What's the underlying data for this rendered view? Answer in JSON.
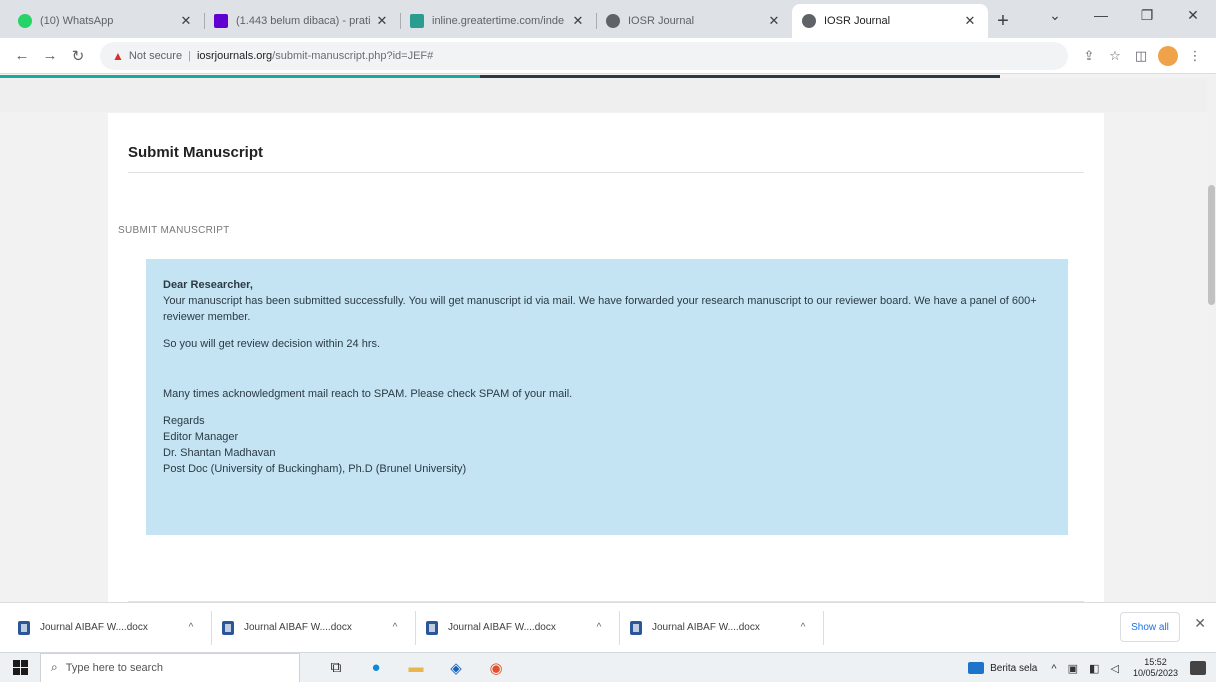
{
  "browser": {
    "tabs": [
      {
        "title": "(10) WhatsApp",
        "favicon_color": "#25d366",
        "active": false
      },
      {
        "title": "(1.443 belum dibaca) - prati",
        "favicon_color": "#6001d2",
        "active": false
      },
      {
        "title": "inline.greatertime.com/inde",
        "favicon_color": "#2a9d8f",
        "active": false
      },
      {
        "title": "IOSR Journal",
        "favicon_color": "#5f6368",
        "active": false
      },
      {
        "title": "IOSR Journal",
        "favicon_color": "#5f6368",
        "active": true
      }
    ],
    "new_tab_glyph": "+",
    "address": {
      "security_text": "Not secure",
      "host": "iosrjournals.org",
      "path": "/submit-manuscript.php?id=JEF#"
    }
  },
  "page": {
    "card_title": "Submit Manuscript",
    "section_label": "SUBMIT MANUSCRIPT",
    "notice": {
      "greeting": "Dear Researcher,",
      "line1": "Your manuscript has been submitted successfully. You will get manuscript id via mail. We have forwarded your research manuscript to our reviewer board. We have a panel of 600+ reviewer member.",
      "line2": "So you will get review decision within 24 hrs.",
      "line3": "Many times acknowledgment mail reach to SPAM. Please check SPAM of your mail.",
      "sign_regards": "Regards",
      "sign_role": "Editor Manager",
      "sign_name": "Dr. Shantan Madhavan",
      "sign_credentials": "Post Doc (University of Buckingham), Ph.D (Brunel University)"
    }
  },
  "downloads": {
    "items": [
      {
        "name": "Journal AIBAF W....docx"
      },
      {
        "name": "Journal AIBAF W....docx"
      },
      {
        "name": "Journal AIBAF W....docx"
      },
      {
        "name": "Journal AIBAF W....docx"
      }
    ],
    "show_all_label": "Show all"
  },
  "taskbar": {
    "search_placeholder": "Type here to search",
    "news_label": "Berita sela",
    "time": "15:52",
    "date": "10/05/2023"
  },
  "colors": {
    "notice_bg": "#c4e4f4",
    "accent_teal": "#1aa89a"
  }
}
